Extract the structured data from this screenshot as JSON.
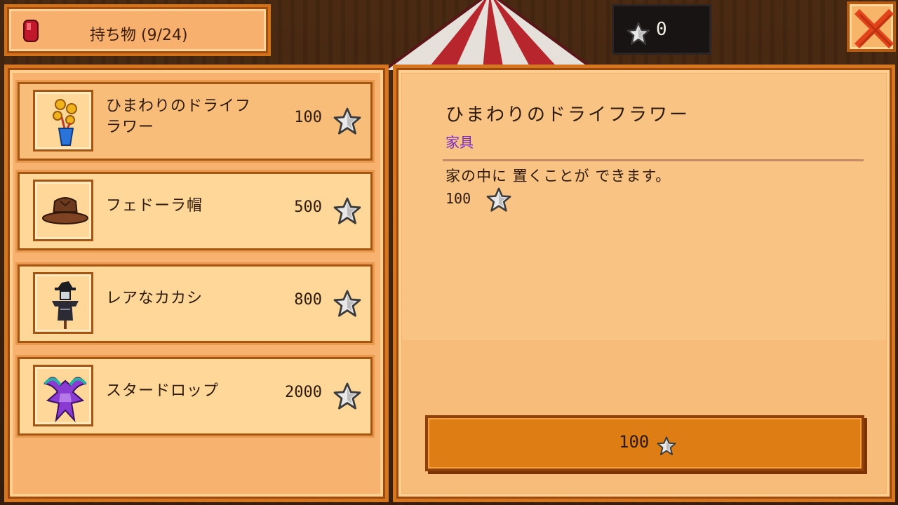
{
  "header": {
    "inventory_label": "持ち物 (9/24)",
    "star_token_count": "0",
    "close_icon": "close-x-icon"
  },
  "shop": {
    "currency_icon": "star-token-icon",
    "items": [
      {
        "name": "ひまわりのドライフラワー",
        "price": "100",
        "icon": "dried-sunflower-icon",
        "selected": true
      },
      {
        "name": "フェドーラ帽",
        "price": "500",
        "icon": "fedora-hat-icon",
        "selected": false
      },
      {
        "name": "レアなカカシ",
        "price": "800",
        "icon": "rare-scarecrow-icon",
        "selected": false
      },
      {
        "name": "スタードロップ",
        "price": "2000",
        "icon": "stardrop-icon",
        "selected": false
      }
    ]
  },
  "detail": {
    "title": "ひまわりのドライフラワー",
    "category": "家具",
    "description": "家の中に 置くことが できます。",
    "price": "100",
    "buy_label": "100"
  },
  "colors": {
    "panel": "#f6b26e",
    "panel_border": "#d57620",
    "row_bg": "#ffd899",
    "category_text": "#7a2cc4",
    "buy_button": "#dd7d14"
  }
}
